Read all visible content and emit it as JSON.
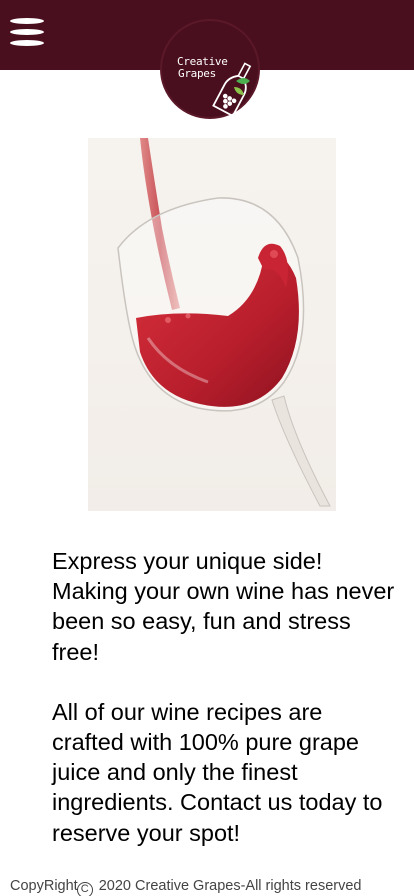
{
  "header": {
    "menu_icon": "hamburger-menu-icon",
    "logo_line1": "Creative",
    "logo_line2": "Grapes",
    "logo_icon": "wine-bottle-grapes-icon",
    "background_color": "#4a0f1e"
  },
  "hero": {
    "image": "red-wine-pouring-into-glass"
  },
  "content": {
    "paragraph1": "Express your unique side! Making your own wine has never been so easy, fun and stress free!",
    "paragraph2": "All of our wine recipes are crafted with 100% pure grape juice and only the finest ingredients. Contact us today to reserve your spot!"
  },
  "footer": {
    "prefix": "CopyRight",
    "symbol": "C",
    "text": "2020 Creative Grapes-All rights reserved"
  }
}
